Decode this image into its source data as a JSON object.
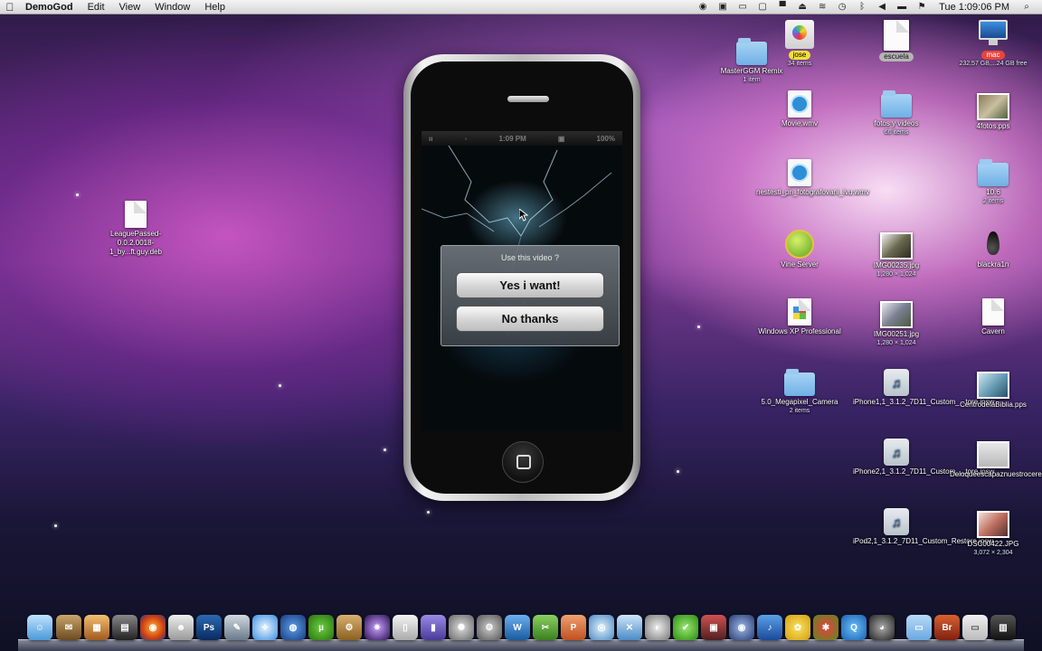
{
  "menubar": {
    "app_name": "DemoGod",
    "menus": [
      "Edit",
      "View",
      "Window",
      "Help"
    ],
    "clock": "Tue 1:09:06 PM"
  },
  "desktop": {
    "league": {
      "name": "LeaguePassed-0.0.2.0018-1_by...ft.guy.deb"
    },
    "mastergm": {
      "name": "MasterGGM Remix",
      "sub": "1 item"
    },
    "jose": {
      "name": "jose",
      "sub": "34 items"
    },
    "escuela": {
      "name": "escuela"
    },
    "mac": {
      "name": "mac",
      "sub": "232.57 GB,...24 GB free"
    },
    "movie": {
      "name": "Movie.wmv"
    },
    "fotos": {
      "name": "fotos y videos",
      "sub": "66 items"
    },
    "fourfotos": {
      "name": "4fotos.pps"
    },
    "nestesti": {
      "name": "nestesti_pri_fotografovani_lvu.wmv"
    },
    "ten6": {
      "name": "10.6",
      "sub": "2 items"
    },
    "vine": {
      "name": "Vine Server"
    },
    "img235": {
      "name": "IMG00235.jpg",
      "sub": "1,280 × 1,024"
    },
    "blackra1n": {
      "name": "blackra1n"
    },
    "winxp": {
      "name": "Windows XP Professional"
    },
    "img251": {
      "name": "IMG00251.jpg",
      "sub": "1,280 × 1,024"
    },
    "cavern": {
      "name": "Cavern"
    },
    "megapixel": {
      "name": "5.0_Megapixel_Camera",
      "sub": "2 items"
    },
    "iphone11": {
      "name": "iPhone1,1_3.1.2_7D11_Custom_...tore.ipsw"
    },
    "centro": {
      "name": "CentrodelaBiblia.pps"
    },
    "iphone21": {
      "name": "iPhone2,1_3.1.2_7D11_Custom_...tore.ipsw"
    },
    "deloque": {
      "name": "Deloqueescapaznuestrocerebro.pps"
    },
    "ipod21": {
      "name": "iPod2,1_3.1.2_7D11_Custom_Restore.ipsw"
    },
    "dsc": {
      "name": "DSC00422.JPG",
      "sub": "3,072 × 2,304"
    }
  },
  "iphone": {
    "status_time": "1:09 PM",
    "battery": "100%",
    "dialog": {
      "title": "Use this video ?",
      "yes_label": "Yes i want!",
      "no_label": "No thanks"
    }
  },
  "colors": {
    "dialog_bg": "#5f676e",
    "folder_blue": "#7fb8e8",
    "tag_yellow": "#f3e03a",
    "tag_red": "#e8453c",
    "tag_gray": "#b5b5b5"
  },
  "dock": {
    "icons": [
      "finder-icon",
      "preview-icon",
      "iphoto-icon",
      "calculator-icon",
      "firefox-icon",
      "automator-icon",
      "photoshop-icon",
      "script-editor-icon",
      "safari-icon",
      "google-earth-icon",
      "utorrent-icon",
      "archive-icon",
      "photo-booth-icon",
      "iphone-config-icon",
      "quicktime-icon",
      "disk-utility-icon",
      "system-prefs-icon",
      "itunes-icon",
      "time-machine-icon",
      "cyberduck-icon",
      "stuffit-icon",
      "vlc-icon",
      "x11-icon",
      "checkmark-icon",
      "network-icon",
      "capture-icon",
      "growl-icon",
      "adium-icon",
      "quick-icon",
      "preview-doc-icon",
      "dvd-icon",
      "downloads-icon",
      "bridge-icon",
      "keyboard-icon",
      "trash-icon"
    ]
  }
}
